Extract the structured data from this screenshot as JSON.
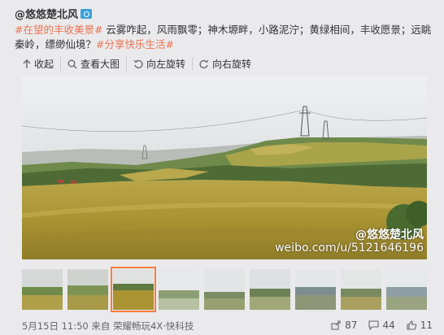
{
  "post": {
    "username": "@悠悠楚北风",
    "camera_icon": "camera-icon",
    "text_segments": [
      {
        "text": "#在望的丰收美景#",
        "tag": true
      },
      {
        "text": " 云雾咋起，风雨飘零；神木塬畔，小路泥泞；黄绿相间，丰收愿景；远眺秦岭，缥缈仙境？",
        "tag": false
      },
      {
        "text": "#分享快乐生活#",
        "tag": true
      }
    ]
  },
  "toolbar": {
    "collapse": "收起",
    "view_large": "查看大图",
    "rotate_left": "向左旋转",
    "rotate_right": "向右旋转"
  },
  "photo": {
    "watermark_line1": "@悠悠楚北风",
    "watermark_line2": "weibo.com/u/5121646196"
  },
  "thumbnails": {
    "count": 9,
    "selected_index": 2
  },
  "footer": {
    "date": "5月15日 11:50",
    "source_prefix": "来自",
    "source": "荣耀畅玩4X·快科技",
    "shares": "87",
    "comments": "44",
    "likes": "11"
  },
  "colors": {
    "tag": "#eb7350",
    "accent": "#fa7d3c"
  }
}
